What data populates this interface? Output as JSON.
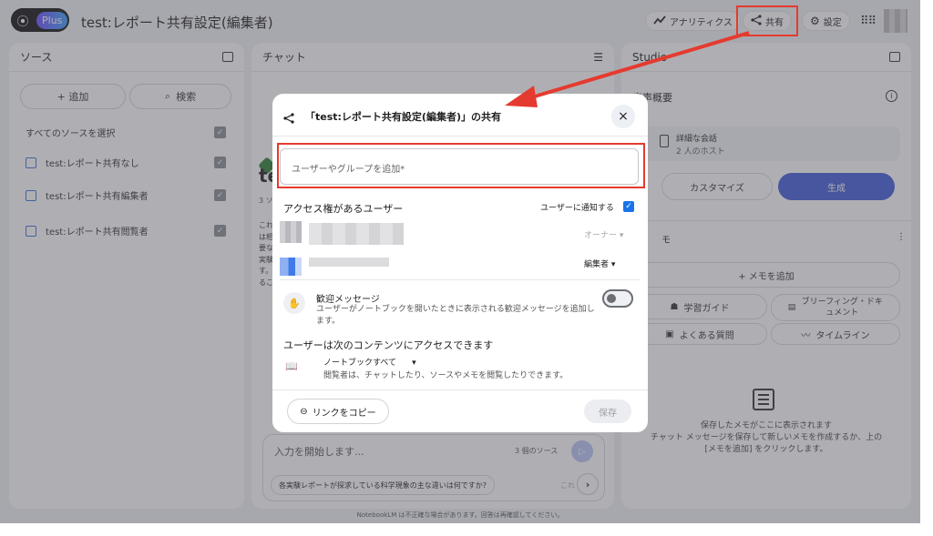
{
  "header": {
    "logo_icon": "⦿",
    "plus_label": "Plus",
    "title": "test:レポート共有設定(編集者)",
    "analytics": "アナリティクス",
    "share": "共有",
    "settings": "設定"
  },
  "sources": {
    "title": "ソース",
    "add": "+ 追加",
    "search": "検索",
    "select_all": "すべてのソースを選択",
    "items": [
      {
        "label": "test:レポート共有なし"
      },
      {
        "label": "test:レポート共有編集者"
      },
      {
        "label": "test:レポート共有閲覧者"
      }
    ]
  },
  "chat": {
    "title": "チャット",
    "heading_frag": "te",
    "meta_frag": "3 ソ",
    "body_frags": [
      "これ",
      "は相",
      "要な",
      "実験",
      "す。",
      "るこ"
    ],
    "input_placeholder": "入力を開始します...",
    "source_count": "3 個のソース",
    "suggestion": "各実験レポートが探求している科学現象の主な違いは何ですか?",
    "suggestion_next": "これ"
  },
  "studio": {
    "title": "Studio",
    "audio_title": "音声概要",
    "audio_item_title": "詳細な会話",
    "audio_item_sub": "2 人のホスト",
    "customize": "カスタマイズ",
    "generate": "生成",
    "notes_frag": "モ",
    "add_note": "+ メモを追加",
    "study_guide": "学習ガイド",
    "briefing": "ブリーフィング・ドキュメント",
    "faq": "よくある質問",
    "timeline": "タイムライン",
    "empty_line1": "保存したメモがここに表示されます",
    "empty_line2": "チャット メッセージを保存して新しいメモを作成するか、上の",
    "empty_line3": "[メモを追加] をクリックします。"
  },
  "share_dialog": {
    "title": "「test:レポート共有設定(編集者)」の共有",
    "input_placeholder": "ユーザーやグループを追加*",
    "access_heading": "アクセス権があるユーザー",
    "notify_label": "ユーザーに通知する",
    "owner_role": "オーナー",
    "editor_role": "編集者",
    "welcome_title": "歓迎メッセージ",
    "welcome_desc": "ユーザーがノートブックを開いたときに表示される歓迎メッセージを追加します。",
    "content_heading": "ユーザーは次のコンテンツにアクセスできます",
    "notebook_option": "ノートブックすべて",
    "notebook_desc": "閲覧者は、チャットしたり、ソースやメモを閲覧したりできます。",
    "copy_link": "リンクをコピー",
    "save": "保存"
  },
  "footer": "NotebookLM は不正確な場合があります。回答は再確認してください。",
  "colors": {
    "annotation_red": "#e53a2f",
    "accent_blue": "#3f5bd9",
    "checkbox_blue": "#1a73e8"
  }
}
